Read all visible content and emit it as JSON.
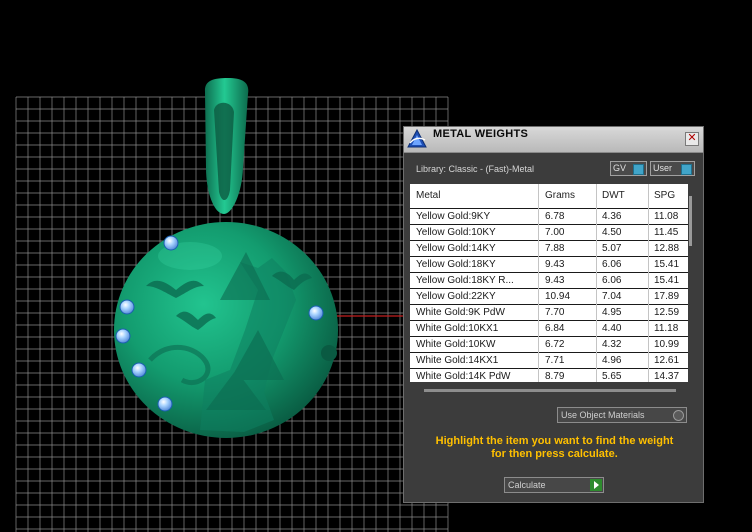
{
  "window": {
    "title": "METAL WEIGHTS",
    "close_glyph": "✕",
    "library_label": "Library: Classic - (Fast)-Metal",
    "gv_label": "GV",
    "user_label": "User"
  },
  "table": {
    "columns": [
      "Metal",
      "Grams",
      "DWT",
      "SPG"
    ],
    "rows": [
      [
        "Yellow Gold:9KY",
        "6.78",
        "4.36",
        "11.08"
      ],
      [
        "Yellow Gold:10KY",
        "7.00",
        "4.50",
        "11.45"
      ],
      [
        "Yellow Gold:14KY",
        "7.88",
        "5.07",
        "12.88"
      ],
      [
        "Yellow Gold:18KY",
        "9.43",
        "6.06",
        "15.41"
      ],
      [
        "Yellow Gold:18KY R...",
        "9.43",
        "6.06",
        "15.41"
      ],
      [
        "Yellow Gold:22KY",
        "10.94",
        "7.04",
        "17.89"
      ],
      [
        "White Gold:9K PdW",
        "7.70",
        "4.95",
        "12.59"
      ],
      [
        "White Gold:10KX1",
        "6.84",
        "4.40",
        "11.18"
      ],
      [
        "White Gold:10KW",
        "6.72",
        "4.32",
        "10.99"
      ],
      [
        "White Gold:14KX1",
        "7.71",
        "4.96",
        "12.61"
      ],
      [
        "White Gold:14K PdW",
        "8.79",
        "5.65",
        "14.37"
      ]
    ]
  },
  "options": {
    "use_object_materials": "Use Object Materials"
  },
  "instruction": {
    "line1": "Highlight the item you want to find the weight",
    "line2": "for then press calculate."
  },
  "calculate_label": "Calculate",
  "colors": {
    "pendant": "#16a77a",
    "gem": "#8fc6ff",
    "instruction": "#ffc000",
    "accent": "#41a5c9"
  },
  "icons": {
    "logo": "gemvision-triangle-logo-icon",
    "close": "close-icon",
    "calc": "play-arrow-icon"
  }
}
